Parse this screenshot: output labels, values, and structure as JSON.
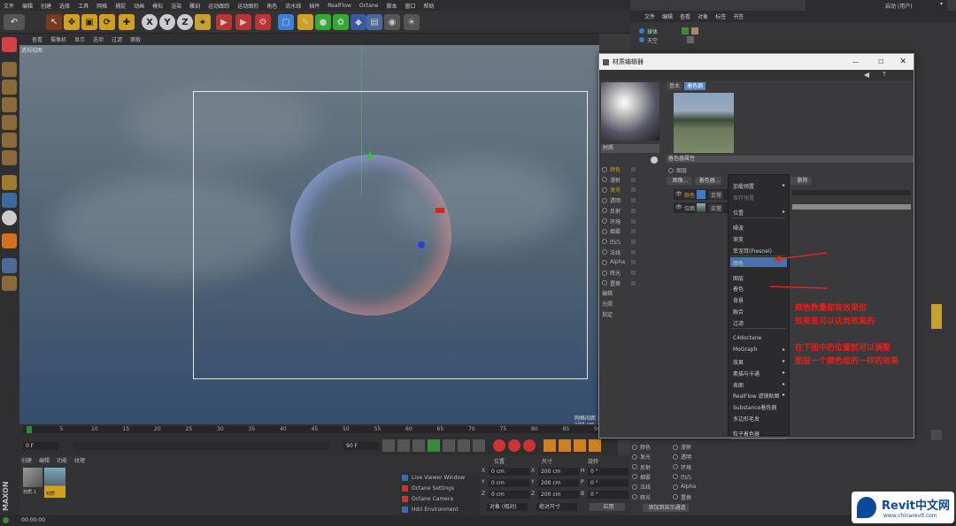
{
  "menubar": [
    "文件",
    "编辑",
    "创建",
    "选择",
    "工具",
    "网格",
    "捕捉",
    "动画",
    "模拟",
    "渲染",
    "雕刻",
    "运动跟踪",
    "运动图形",
    "角色",
    "流水线",
    "插件",
    "RealFlow",
    "Octane",
    "脚本",
    "窗口",
    "帮助"
  ],
  "layout_label": "启动 (用户)",
  "toolbar_icons": [
    "undo-icon",
    "move-icon",
    "scale-icon",
    "rotate-icon",
    "x-axis-icon",
    "y-axis-icon",
    "z-axis-icon",
    "render-icon",
    "cube-icon",
    "pen-icon",
    "array-icon",
    "deformer-icon",
    "camera-icon",
    "light-icon"
  ],
  "viewport": {
    "menus": [
      "查看",
      "摄像机",
      "显示",
      "选项",
      "过滤",
      "面板"
    ],
    "label": "透视视图",
    "footer": "网格间距 : 100 cm"
  },
  "timeline": {
    "ticks": [
      "0",
      "5",
      "10",
      "15",
      "20",
      "25",
      "30",
      "35",
      "40",
      "45",
      "50",
      "55",
      "60",
      "65",
      "70",
      "75",
      "80",
      "85",
      "90"
    ],
    "start": "0 F",
    "end": "90 F",
    "current": "0 F"
  },
  "material_manager": {
    "menus": [
      "创建",
      "编辑",
      "功能",
      "纹理"
    ],
    "materials": [
      "材质.1",
      "材质"
    ]
  },
  "octane_menu": [
    "Live Viewer Window",
    "Octane Settings",
    "Octane Camera",
    "Hdri Environment"
  ],
  "coords": {
    "headers": [
      "位置",
      "尺寸",
      "旋转"
    ],
    "rows": [
      {
        "axis": "X",
        "pos": "0 cm",
        "size": "200 cm",
        "rot_label": "H",
        "rot": "0 °"
      },
      {
        "axis": "Y",
        "pos": "0 cm",
        "size": "200 cm",
        "rot_label": "P",
        "rot": "0 °"
      },
      {
        "axis": "Z",
        "pos": "0 cm",
        "size": "200 cm",
        "rot_label": "B",
        "rot": "0 °"
      }
    ],
    "mode": "对象 (相对)",
    "size_mode": "绝对尺寸",
    "apply": "应用"
  },
  "object_manager": {
    "menus": [
      "文件",
      "编辑",
      "查看",
      "对象",
      "标签",
      "书签"
    ],
    "objects": [
      "球体",
      "天空"
    ]
  },
  "material_editor": {
    "title": "材质编辑器",
    "tabs": [
      "基本",
      "着色器"
    ],
    "mat_name": "材质",
    "channels": [
      "颜色",
      "漫射",
      "发光",
      "透明",
      "反射",
      "环境",
      "烟雾",
      "凹凸",
      "法线",
      "Alpha",
      "辉光",
      "置换",
      "编辑",
      "光照",
      "指定"
    ],
    "section": "着色器属性",
    "shader_label": "图层",
    "buttons": [
      "图像...",
      "着色器...",
      "删除"
    ],
    "layers": [
      {
        "name": "颜色",
        "mode": "正常"
      },
      {
        "name": "位图",
        "mode": "正常"
      }
    ]
  },
  "context_menu": {
    "items": [
      "加载预置",
      "保存预置",
      "位置",
      "噪波",
      "渐变",
      "菲涅耳(Fresnel)",
      "颜色",
      "图层",
      "着色",
      "背景",
      "融合",
      "过滤",
      "C4doctane",
      "MoGraph",
      "效果",
      "素描与卡通",
      "表面",
      "RealFlow 滤镜贴图",
      "Substance着色器",
      "多边形毛发",
      "粒子着色器"
    ],
    "highlighted": "颜色"
  },
  "annotations": [
    "颜色数量都有效果但",
    "效果是可以达到效果的",
    "在下图中的位置就可以调整",
    "图层一个颜色组的一样的效果"
  ],
  "attributes": {
    "channels_left": [
      "颜色",
      "发光",
      "反射",
      "烟雾",
      "法线",
      "辉光"
    ],
    "channels_right": [
      "漫射",
      "透明",
      "环境",
      "凹凸",
      "Alpha",
      "置换"
    ],
    "button": "添加到显示通道"
  },
  "status": "00:00:00",
  "logo": {
    "title": "Revit中文网",
    "url": "www.chinarevit.com"
  },
  "colors": {
    "accent": "#5b87c9",
    "highlight": "#4a70b0",
    "annotation": "#e0201a",
    "arrow": "#d72a24"
  }
}
